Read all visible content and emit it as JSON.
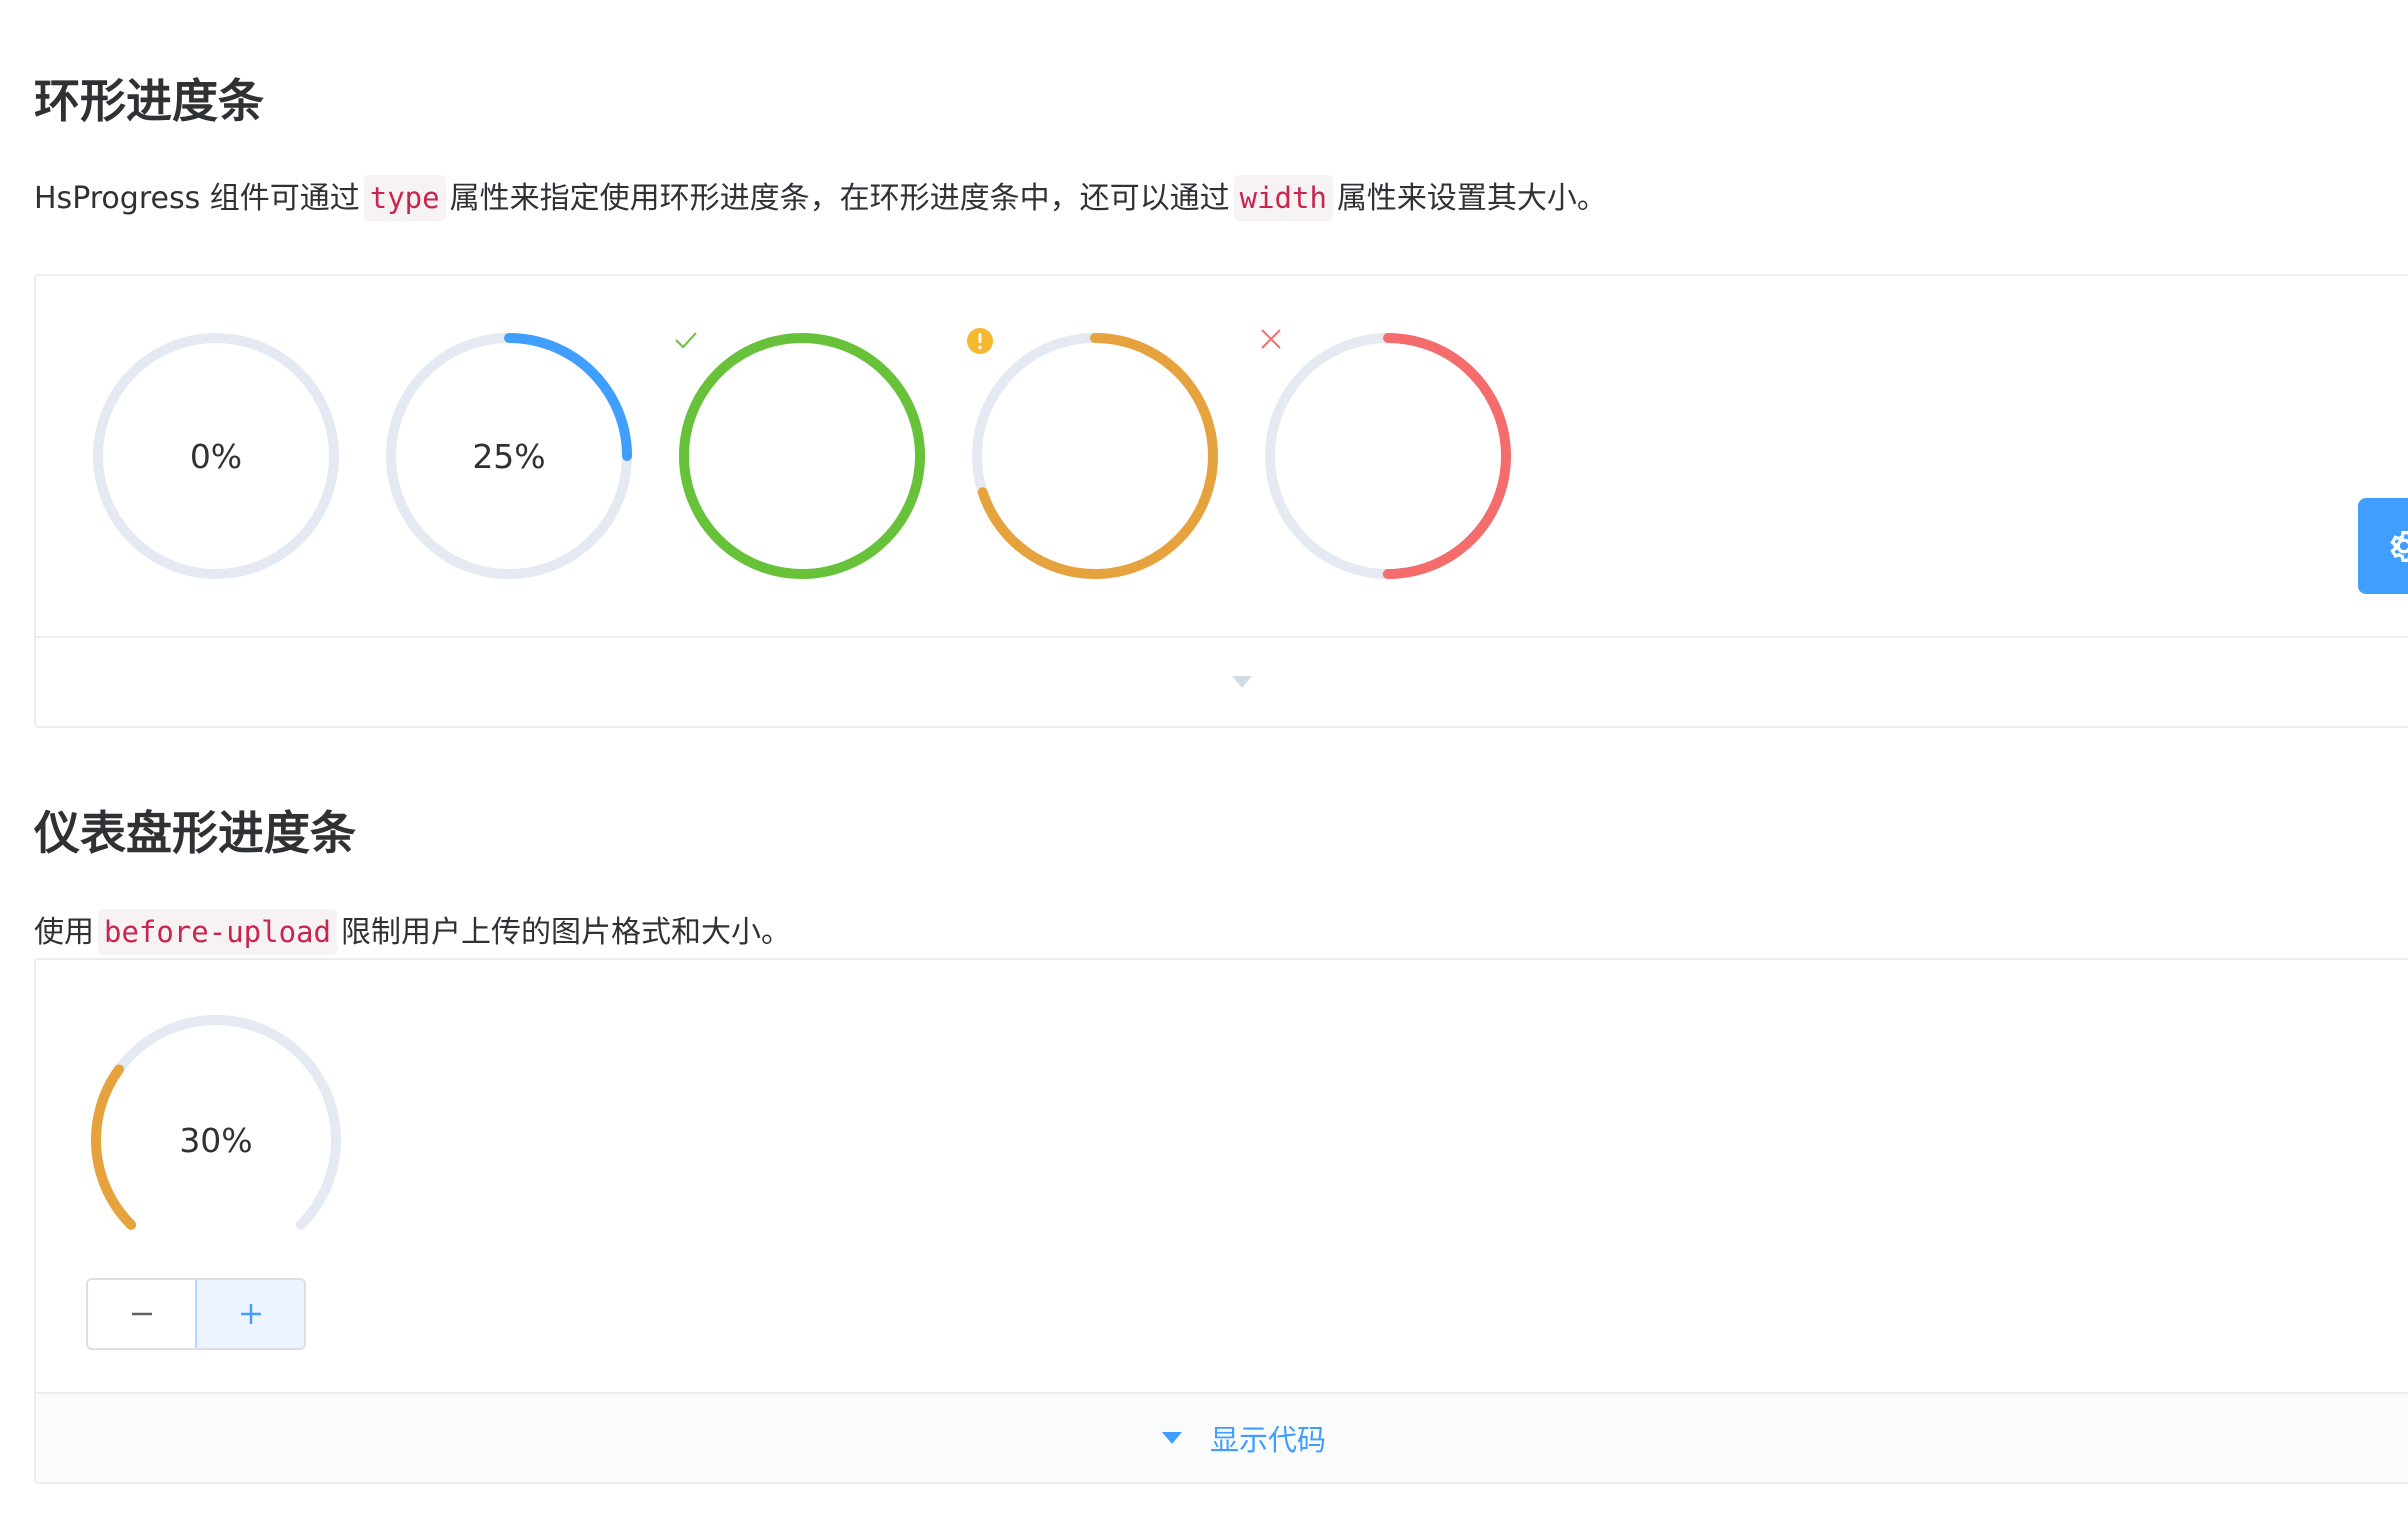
{
  "section1": {
    "title": "环形进度条",
    "desc_part1": "HsProgress 组件可通过",
    "desc_code1": "type",
    "desc_part2": "属性来指定使用环形进度条，在环形进度条中，还可以通过",
    "desc_code2": "width",
    "desc_part3": "属性来设置其大小。",
    "rings": [
      {
        "label": "0%",
        "percentage": 0,
        "status": "default",
        "color": "#409eff"
      },
      {
        "label": "25%",
        "percentage": 25,
        "status": "default",
        "color": "#409eff"
      },
      {
        "label": "",
        "percentage": 100,
        "status": "success",
        "color": "#67c23a",
        "icon": "check-icon"
      },
      {
        "label": "",
        "percentage": 70,
        "status": "warning",
        "color": "#e6a23c",
        "icon": "warning-icon"
      },
      {
        "label": "",
        "percentage": 50,
        "status": "exception",
        "color": "#f56c6c",
        "icon": "close-icon"
      }
    ]
  },
  "section2": {
    "title": "仪表盘形进度条",
    "desc_part1": "使用",
    "desc_code1": "before-upload",
    "desc_part2": "限制用户上传的图片格式和大小。",
    "dashboard": {
      "label": "30%",
      "percentage": 30,
      "color": "#e6a23c"
    },
    "minus_icon": "minus-icon",
    "plus_icon": "plus-icon",
    "show_code_label": "显示代码"
  },
  "colors": {
    "track": "#e5e9f2",
    "primary": "#409eff",
    "success": "#67c23a",
    "warning": "#e6a23c",
    "danger": "#f56c6c"
  }
}
